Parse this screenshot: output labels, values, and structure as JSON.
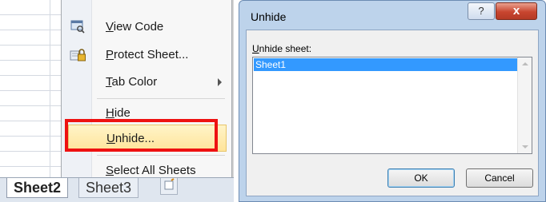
{
  "context_menu": {
    "items": [
      {
        "pre": "",
        "u": "V",
        "post": "iew Code",
        "icon": "view-code-icon"
      },
      {
        "pre": "",
        "u": "P",
        "post": "rotect Sheet...",
        "icon": "protect-sheet-icon"
      },
      {
        "pre": "",
        "u": "T",
        "post": "ab Color",
        "submenu": true
      },
      {
        "pre": "",
        "u": "H",
        "post": "ide"
      },
      {
        "pre": "",
        "u": "U",
        "post": "nhide...",
        "highlighted": true
      },
      {
        "pre": "",
        "u": "S",
        "post": "elect All Sheets"
      }
    ]
  },
  "sheet_tabs": [
    "Sheet2",
    "Sheet3"
  ],
  "dialog": {
    "title": "Unhide",
    "help_label": "?",
    "close_label": "x",
    "list_label_u": "U",
    "list_label_rest": "nhide sheet:",
    "sheets": [
      "Sheet1"
    ],
    "ok_label": "OK",
    "cancel_label": "Cancel"
  },
  "colors": {
    "highlight_box": "#ee1111",
    "selection": "#3399ff"
  }
}
